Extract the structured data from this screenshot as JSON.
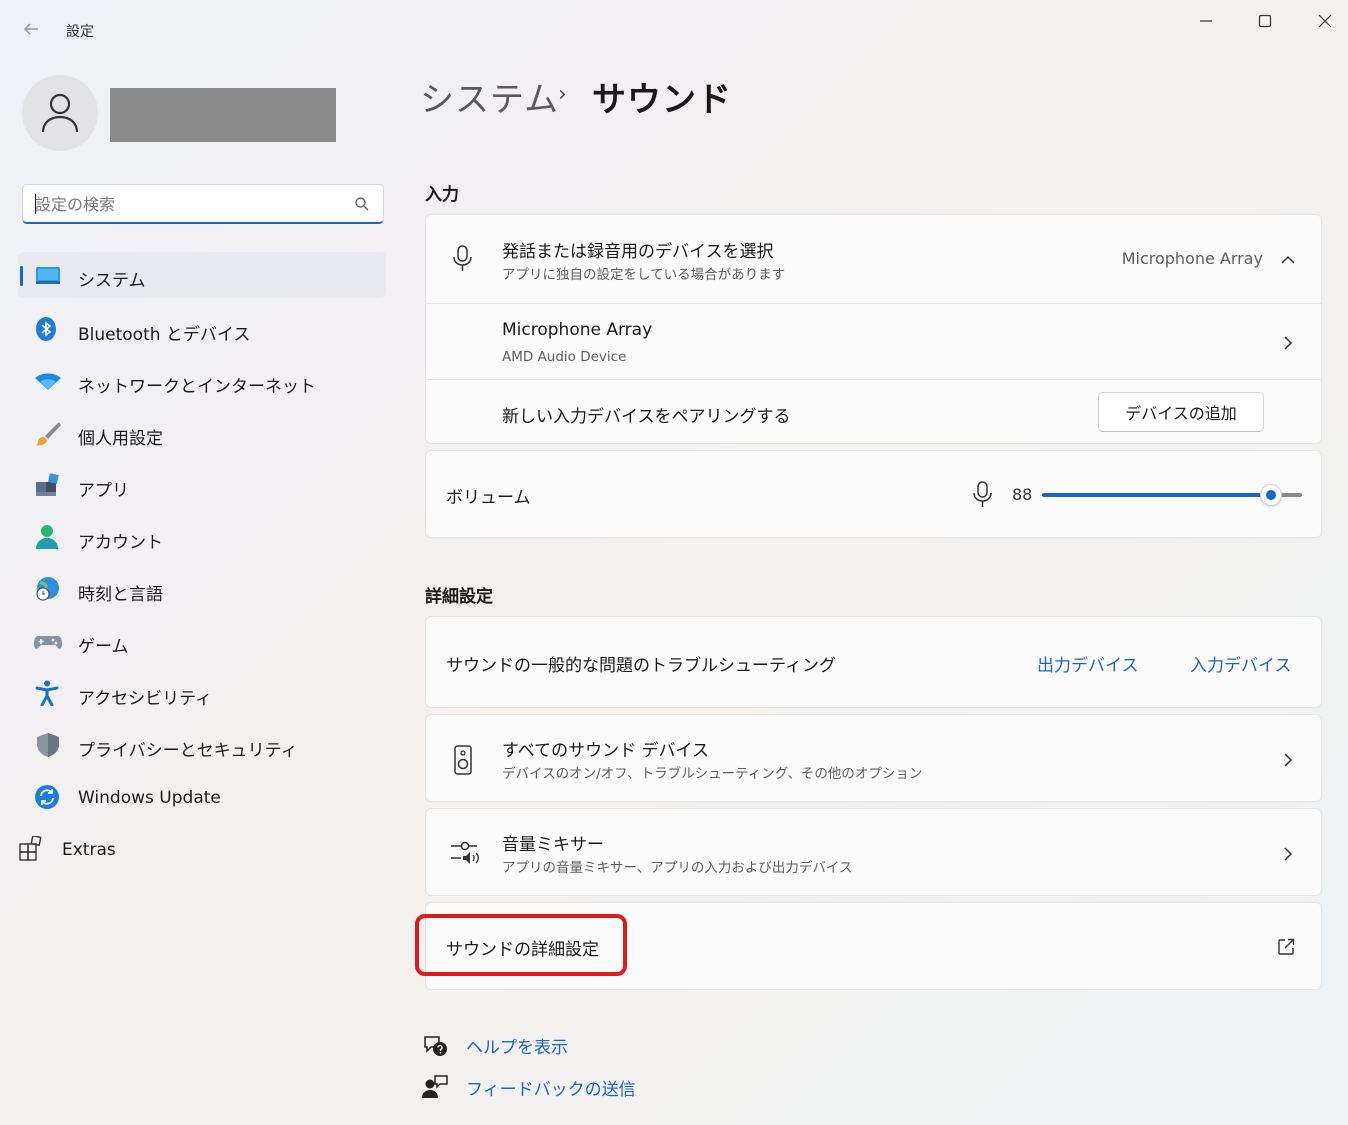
{
  "window": {
    "title": "設定"
  },
  "search": {
    "placeholder": "設定の検索"
  },
  "sidebar": {
    "items": [
      {
        "label": "システム",
        "active": true
      },
      {
        "label": "Bluetooth とデバイス"
      },
      {
        "label": "ネットワークとインターネット"
      },
      {
        "label": "個人用設定"
      },
      {
        "label": "アプリ"
      },
      {
        "label": "アカウント"
      },
      {
        "label": "時刻と言語"
      },
      {
        "label": "ゲーム"
      },
      {
        "label": "アクセシビリティ"
      },
      {
        "label": "プライバシーとセキュリティ"
      },
      {
        "label": "Windows Update"
      },
      {
        "label": "Extras"
      }
    ]
  },
  "breadcrumb": {
    "parent": "システム",
    "separator": "›",
    "current": "サウンド"
  },
  "input": {
    "section_title": "入力",
    "device_select_title": "発話または録音用のデバイスを選択",
    "device_select_subtitle": "アプリに独自の設定をしている場合があります",
    "device_select_value": "Microphone Array",
    "device_name": "Microphone Array",
    "device_desc": "AMD Audio Device",
    "pair_label": "新しい入力デバイスをペアリングする",
    "add_device_button": "デバイスの追加",
    "volume_label": "ボリューム",
    "volume_value": "88",
    "volume_level": 0.88
  },
  "advanced": {
    "section_title": "詳細設定",
    "troubleshoot_label": "サウンドの一般的な問題のトラブルシューティング",
    "troubleshoot_output_link": "出力デバイス",
    "troubleshoot_input_link": "入力デバイス",
    "all_devices_title": "すべてのサウンド デバイス",
    "all_devices_subtitle": "デバイスのオン/オフ、トラブルシューティング、その他のオプション",
    "mixer_title": "音量ミキサー",
    "mixer_subtitle": "アプリの音量ミキサー、アプリの入力および出力デバイス",
    "more_settings_label": "サウンドの詳細設定"
  },
  "footer": {
    "help_label": "ヘルプを表示",
    "feedback_label": "フィードバックの送信"
  },
  "colors": {
    "accent": "#1d64c8",
    "highlight_box": "#e0191e"
  },
  "icons": {
    "back": "back-arrow-icon",
    "search": "search-icon",
    "microphone": "microphone-icon",
    "speaker": "speaker-icon",
    "mixer": "mixer-icon",
    "external": "external-link-icon",
    "help": "help-icon",
    "feedback": "feedback-icon"
  }
}
